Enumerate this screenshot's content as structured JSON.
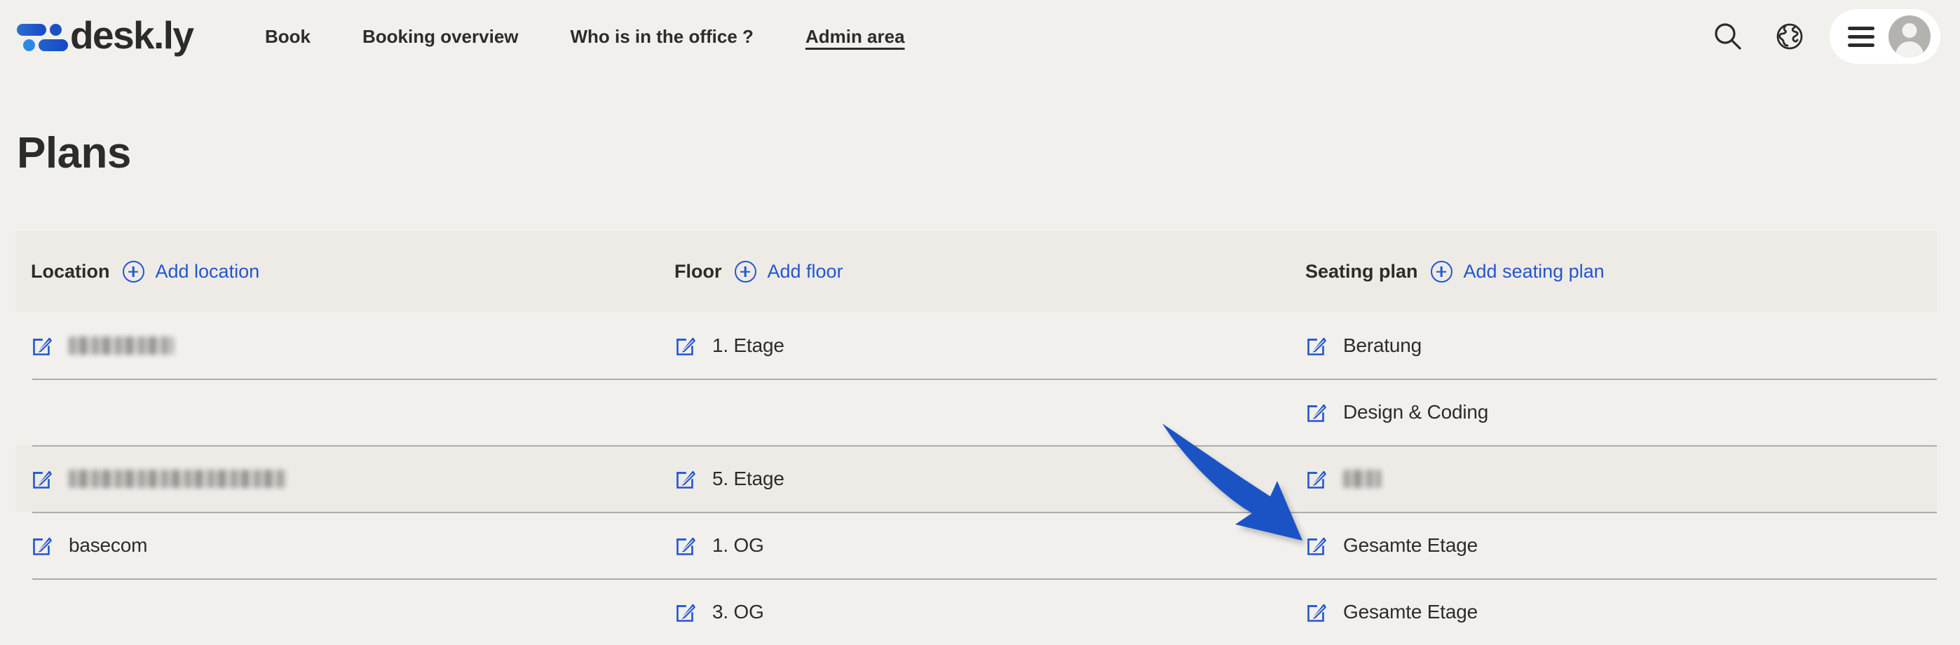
{
  "header": {
    "brand": "desk.ly",
    "nav": [
      {
        "label": "Book",
        "active": false
      },
      {
        "label": "Booking overview",
        "active": false
      },
      {
        "label": "Who is in the office ?",
        "active": false
      },
      {
        "label": "Admin area",
        "active": true
      }
    ],
    "actions": {
      "search_icon": "search-icon",
      "language_icon": "globe-icon",
      "menu_icon": "hamburger-icon",
      "avatar_icon": "user-avatar-icon"
    }
  },
  "page": {
    "title": "Plans"
  },
  "table": {
    "columns": [
      {
        "title": "Location",
        "add_label": "Add location",
        "add_icon": "plus-circle-icon"
      },
      {
        "title": "Floor",
        "add_label": "Add floor",
        "add_icon": "plus-circle-icon"
      },
      {
        "title": "Seating plan",
        "add_label": "Add seating plan",
        "add_icon": "plus-circle-icon"
      }
    ],
    "rows": [
      {
        "shaded": false,
        "rule": false,
        "location": {
          "has_icon": true,
          "text": "",
          "redacted": true,
          "redacted_width": 150
        },
        "floor": {
          "has_icon": true,
          "text": "1. Etage",
          "redacted": false
        },
        "seating_plan": {
          "has_icon": true,
          "text": "Beratung",
          "redacted": false
        }
      },
      {
        "shaded": false,
        "rule": true,
        "location": {
          "has_icon": false,
          "text": "",
          "redacted": false
        },
        "floor": {
          "has_icon": false,
          "text": "",
          "redacted": false
        },
        "seating_plan": {
          "has_icon": true,
          "text": "Design & Coding",
          "redacted": false
        }
      },
      {
        "shaded": true,
        "rule": true,
        "location": {
          "has_icon": true,
          "text": "",
          "redacted": true,
          "redacted_width": 310
        },
        "floor": {
          "has_icon": true,
          "text": "5. Etage",
          "redacted": false
        },
        "seating_plan": {
          "has_icon": true,
          "text": "",
          "redacted": true,
          "redacted_width": 54
        }
      },
      {
        "shaded": false,
        "rule": true,
        "location": {
          "has_icon": true,
          "text": "basecom",
          "redacted": false
        },
        "floor": {
          "has_icon": true,
          "text": "1. OG",
          "redacted": false
        },
        "seating_plan": {
          "has_icon": true,
          "text": "Gesamte Etage",
          "redacted": false
        }
      },
      {
        "shaded": false,
        "rule": true,
        "location": {
          "has_icon": false,
          "text": "",
          "redacted": false
        },
        "floor": {
          "has_icon": true,
          "text": "3. OG",
          "redacted": false
        },
        "seating_plan": {
          "has_icon": true,
          "text": "Gesamte Etage",
          "redacted": false
        }
      }
    ]
  },
  "annotation": {
    "arrow_icon": "annotation-arrow-icon",
    "arrow_color": "#1A52C4",
    "points_to": "Gesamte Etage edit icon"
  },
  "colors": {
    "page_background": "#F2F0EC",
    "row_shade": "#EEEBE7",
    "rule": "#AEACA8",
    "accent_blue": "#2256CE",
    "text_dark": "#2C2C2C",
    "avatar_gray": "#B4B2AE"
  }
}
